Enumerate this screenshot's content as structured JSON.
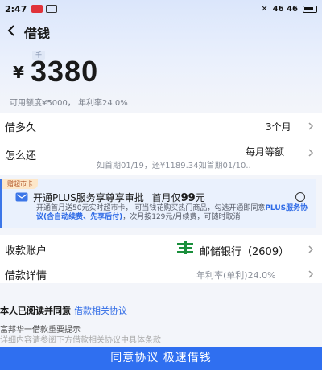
{
  "status_bar": {
    "time": "2:47",
    "right": "46 46"
  },
  "nav": {
    "title": "借钱"
  },
  "amount": {
    "currency": "¥",
    "value": "3380",
    "unit_tag": "千"
  },
  "quota_text": "可用额度¥5000， 年利率24.0%",
  "borrow_term": {
    "label": "借多久",
    "value": "3个月"
  },
  "repay": {
    "label": "怎么还",
    "value": "每月等额",
    "detail": "如首期01/19，还¥1189.34如首期01/10.."
  },
  "promo": {
    "tag": "赠超市卡",
    "title_prefix": "开通PLUS服务享尊享审批",
    "title_suffix": "首月仅",
    "title_price": "99",
    "title_unit": "元",
    "desc_1": "开通首月送50元实时超市卡， 可当钱花购买热门商品，勾选开通即同意",
    "desc_link": "PLUS服务协议(含自动续费、先享后付)",
    "desc_2": "，次月按129元/月续费，可随时取消"
  },
  "account": {
    "label": "收款账户",
    "bank": "邮储银行（2609）"
  },
  "details": {
    "label": "借款详情",
    "value": "年利率(单利)24.0%"
  },
  "agreement": {
    "title": "本人已阅读并同意",
    "link": "借款相关协议"
  },
  "tip": {
    "title": "富邦华一借款重要提示",
    "sub": "详细内容请参阅下方借款相关协议中具体条款"
  },
  "cta": {
    "label": "同意协议 极速借钱"
  },
  "colors": {
    "primary": "#2f6ff0",
    "bank_green": "#1a8f3c"
  }
}
